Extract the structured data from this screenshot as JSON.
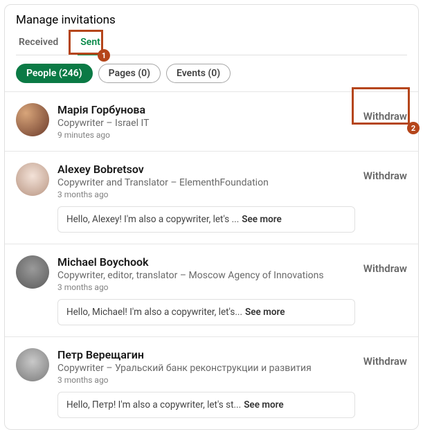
{
  "header": {
    "title": "Manage invitations"
  },
  "tabs": {
    "received": "Received",
    "sent": "Sent"
  },
  "filters": {
    "people": "People (246)",
    "pages": "Pages (0)",
    "events": "Events (0)"
  },
  "action": {
    "withdraw": "Withdraw",
    "seemore": "See more"
  },
  "invitations": [
    {
      "name": "Марія Горбунова",
      "subtitle": "Copywriter – Israel IT",
      "time": "9 minutes ago",
      "message": null
    },
    {
      "name": "Alexey Bobretsov",
      "subtitle": "Copywriter and Translator – ElementhFoundation",
      "time": "3 months ago",
      "message": "Hello, Alexey! I'm also a copywriter, let's ... "
    },
    {
      "name": "Michael Boychook",
      "subtitle": "Copywriter, editor, translator – Moscow Agency of Innovations",
      "time": "3 months ago",
      "message": "Hello, Michael! I'm also a copywriter, let's... "
    },
    {
      "name": "Петр Верещагин",
      "subtitle": "Copywriter – Уральский банк реконструкции и развития",
      "time": "3 months ago",
      "message": "Hello, Петр! I'm also a copywriter, let's st... "
    }
  ],
  "annotations": {
    "badge1": "1",
    "badge2": "2"
  }
}
